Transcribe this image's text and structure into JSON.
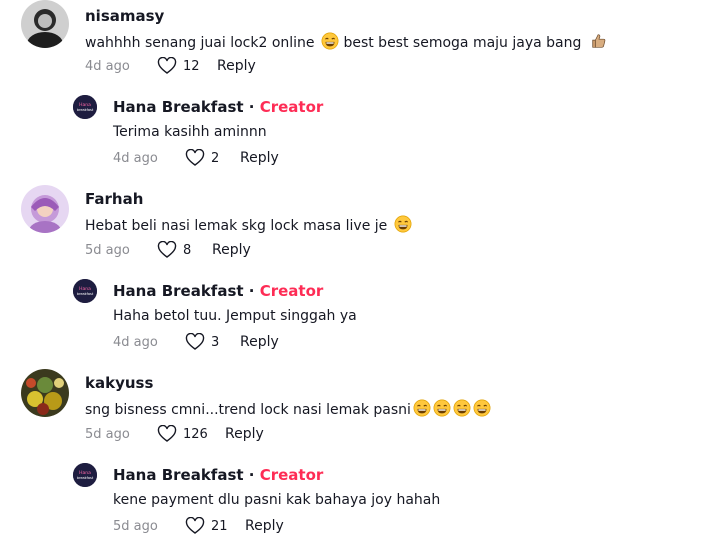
{
  "comments": [
    {
      "username": "nisamasy",
      "text": "wahhhh senang juai lock2 online",
      "text_after": "best best semoga maju jaya bang",
      "time": "4d ago",
      "likes": "12",
      "reply_label": "Reply"
    },
    {
      "username": "Hana Breakfast",
      "badge": "Creator",
      "text": "Terima kasihh aminnn",
      "time": "4d ago",
      "likes": "2",
      "reply_label": "Reply"
    },
    {
      "username": "Farhah",
      "text": "Hebat beli nasi lemak skg lock masa live je",
      "time": "5d ago",
      "likes": "8",
      "reply_label": "Reply"
    },
    {
      "username": "Hana Breakfast",
      "badge": "Creator",
      "text": "Haha betol tuu. Jemput singgah ya",
      "time": "4d ago",
      "likes": "3",
      "reply_label": "Reply"
    },
    {
      "username": "kakyuss",
      "text": "sng bisness cmni...trend lock nasi lemak pasni",
      "time": "5d ago",
      "likes": "126",
      "reply_label": "Reply"
    },
    {
      "username": "Hana Breakfast",
      "badge": "Creator",
      "text": "kene payment dlu pasni kak bahaya joy hahah",
      "time": "5d ago",
      "likes": "21",
      "reply_label": "Reply"
    }
  ],
  "separator": "·",
  "colors": {
    "creator": "#fe2c55",
    "meta": "#8a8b91"
  }
}
